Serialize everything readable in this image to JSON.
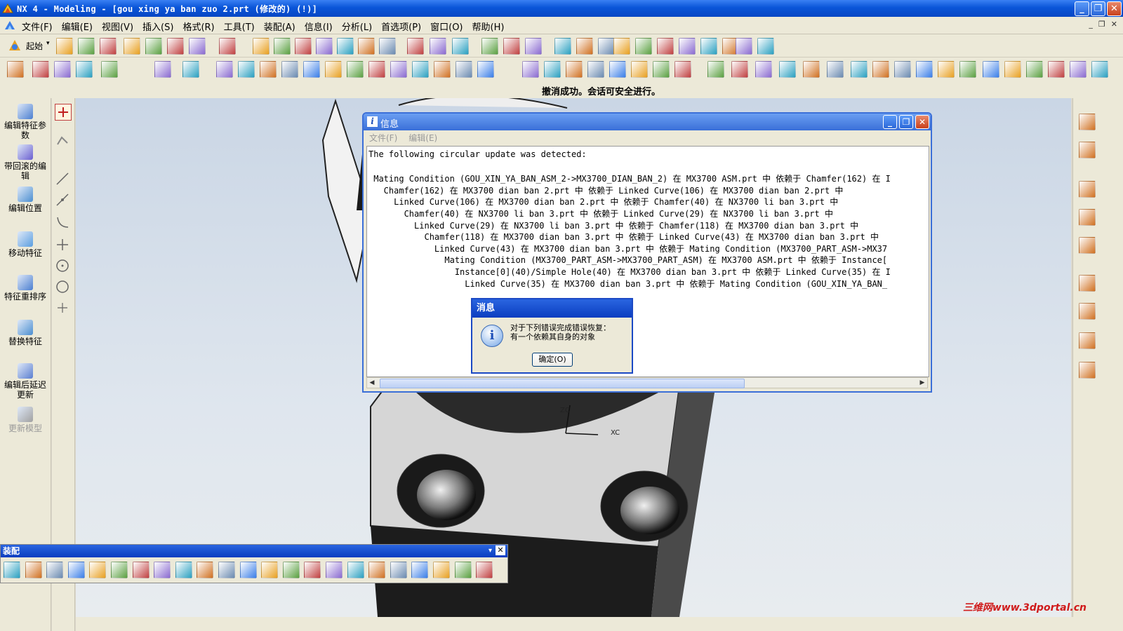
{
  "window": {
    "title": "NX 4 - Modeling - [gou xing ya ban zuo 2.prt  (修改的)     (!)]",
    "minimize_label": "_",
    "maximize_label": "❐",
    "close_label": "✕"
  },
  "menubar": {
    "items": [
      "文件(F)",
      "编辑(E)",
      "视图(V)",
      "插入(S)",
      "格式(R)",
      "工具(T)",
      "装配(A)",
      "信息(I)",
      "分析(L)",
      "首选项(P)",
      "窗口(O)",
      "帮助(H)"
    ],
    "mdi_minimize": "_",
    "mdi_restore": "❐",
    "mdi_close": "✕"
  },
  "toolbar": {
    "start_label": "起始"
  },
  "status": {
    "message": "撤消成功。会话可安全进行。"
  },
  "resource_panel": {
    "items": [
      {
        "label": "编辑特征参数",
        "enabled": true
      },
      {
        "label": "带回滚的编辑",
        "enabled": true
      },
      {
        "label": "编辑位置",
        "enabled": true
      },
      {
        "label": "移动特征",
        "enabled": true
      },
      {
        "label": "特征重排序",
        "enabled": true
      },
      {
        "label": "替换特征",
        "enabled": true
      },
      {
        "label": "编辑后延迟更新",
        "enabled": true
      },
      {
        "label": "更新模型",
        "enabled": false
      }
    ]
  },
  "viewport": {
    "axis_zc": "ZC",
    "axis_xc": "XC"
  },
  "info_window": {
    "title": "信息",
    "menu": [
      "文件(F)",
      "编辑(E)"
    ],
    "lines": [
      "The following circular update was detected:",
      "",
      " Mating Condition (GOU_XIN_YA_BAN_ASM_2->MX3700_DIAN_BAN_2) 在 MX3700 ASM.prt 中 依赖于 Chamfer(162) 在 I",
      "   Chamfer(162) 在 MX3700 dian ban 2.prt 中 依赖于 Linked Curve(106) 在 MX3700 dian ban 2.prt 中",
      "     Linked Curve(106) 在 MX3700 dian ban 2.prt 中 依赖于 Chamfer(40) 在 NX3700 li ban 3.prt 中",
      "       Chamfer(40) 在 NX3700 li ban 3.prt 中 依赖于 Linked Curve(29) 在 NX3700 li ban 3.prt 中",
      "         Linked Curve(29) 在 NX3700 li ban 3.prt 中 依赖于 Chamfer(118) 在 MX3700 dian ban 3.prt 中",
      "           Chamfer(118) 在 MX3700 dian ban 3.prt 中 依赖于 Linked Curve(43) 在 MX3700 dian ban 3.prt 中",
      "             Linked Curve(43) 在 MX3700 dian ban 3.prt 中 依赖于 Mating Condition (MX3700_PART_ASM->MX37",
      "               Mating Condition (MX3700_PART_ASM->MX3700_PART_ASM) 在 MX3700 ASM.prt 中 依赖于 Instance[",
      "                 Instance[0](40)/Simple Hole(40) 在 MX3700 dian ban 3.prt 中 依赖于 Linked Curve(35) 在 I",
      "                   Linked Curve(35) 在 MX3700 dian ban 3.prt 中 依赖于 Mating Condition (GOU_XIN_YA_BAN_"
    ]
  },
  "message_dialog": {
    "title": "消息",
    "line1": "对于下列错误完成错误恢复：",
    "line2": "有一个依赖其自身的对象",
    "ok_label": "确定(O)"
  },
  "assembly_toolbar": {
    "title": "装配",
    "close_label": "✕"
  },
  "watermark": "三维网www.3dportal.cn",
  "colors": {
    "titlebar": "#0a55d8",
    "chrome": "#ece9d8",
    "status_bg": "#ece9d8"
  }
}
